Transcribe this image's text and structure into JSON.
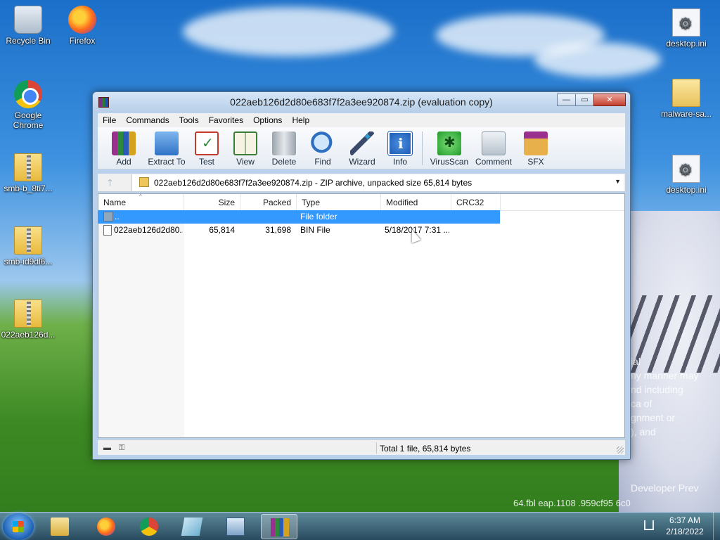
{
  "desktop": {
    "icons": [
      {
        "label": "Recycle Bin"
      },
      {
        "label": "Firefox"
      },
      {
        "label": "Google Chrome"
      },
      {
        "label": "smb-b_8ti7..."
      },
      {
        "label": "smb-id9dl6..."
      },
      {
        "label": "022aeb126d..."
      },
      {
        "label": "desktop.ini"
      },
      {
        "label": "malware-sa..."
      },
      {
        "label": "desktop.ini"
      }
    ]
  },
  "window": {
    "title": "022aeb126d2d80e683f7f2a3ee920874.zip (evaluation copy)",
    "caption_buttons": {
      "minimize": "—",
      "maximize": "▭",
      "close": "✕"
    }
  },
  "menu": [
    "File",
    "Commands",
    "Tools",
    "Favorites",
    "Options",
    "Help"
  ],
  "toolbar": [
    {
      "label": "Add",
      "icon": "add-archive-icon"
    },
    {
      "label": "Extract To",
      "icon": "extract-folder-icon"
    },
    {
      "label": "Test",
      "icon": "test-clipboard-icon"
    },
    {
      "label": "View",
      "icon": "view-book-icon"
    },
    {
      "label": "Delete",
      "icon": "trash-icon"
    },
    {
      "label": "Find",
      "icon": "magnifier-icon"
    },
    {
      "label": "Wizard",
      "icon": "wand-icon"
    },
    {
      "label": "Info",
      "icon": "info-icon"
    },
    {
      "label": "VirusScan",
      "icon": "virus-icon"
    },
    {
      "label": "Comment",
      "icon": "comment-icon"
    },
    {
      "label": "SFX",
      "icon": "sfx-box-icon"
    }
  ],
  "address": {
    "text": "022aeb126d2d80e683f7f2a3ee920874.zip - ZIP archive, unpacked size 65,814 bytes"
  },
  "list": {
    "columns": [
      "Name",
      "Size",
      "Packed",
      "Type",
      "Modified",
      "CRC32"
    ],
    "rows": [
      {
        "name": "..",
        "size": "",
        "packed": "",
        "type": "File folder",
        "modified": "",
        "crc": "",
        "selected": true
      },
      {
        "name": "022aeb126d2d80...",
        "size": "65,814",
        "packed": "31,698",
        "type": "BIN File",
        "modified": "5/18/2017 7:31 ...",
        "crc": "",
        "selected": false
      }
    ]
  },
  "status": {
    "text": "Total 1 file, 65,814 bytes"
  },
  "wallpaper_text": [
    "ial",
    "ny manner may",
    "nd including",
    "ca   of",
    "gnment or",
    "   ), and",
    "Developer Prev",
    "64.fbl   eap.1108   .959cf95   6c0"
  ],
  "clock": {
    "time": "6:37 AM",
    "date": "2/18/2022"
  }
}
